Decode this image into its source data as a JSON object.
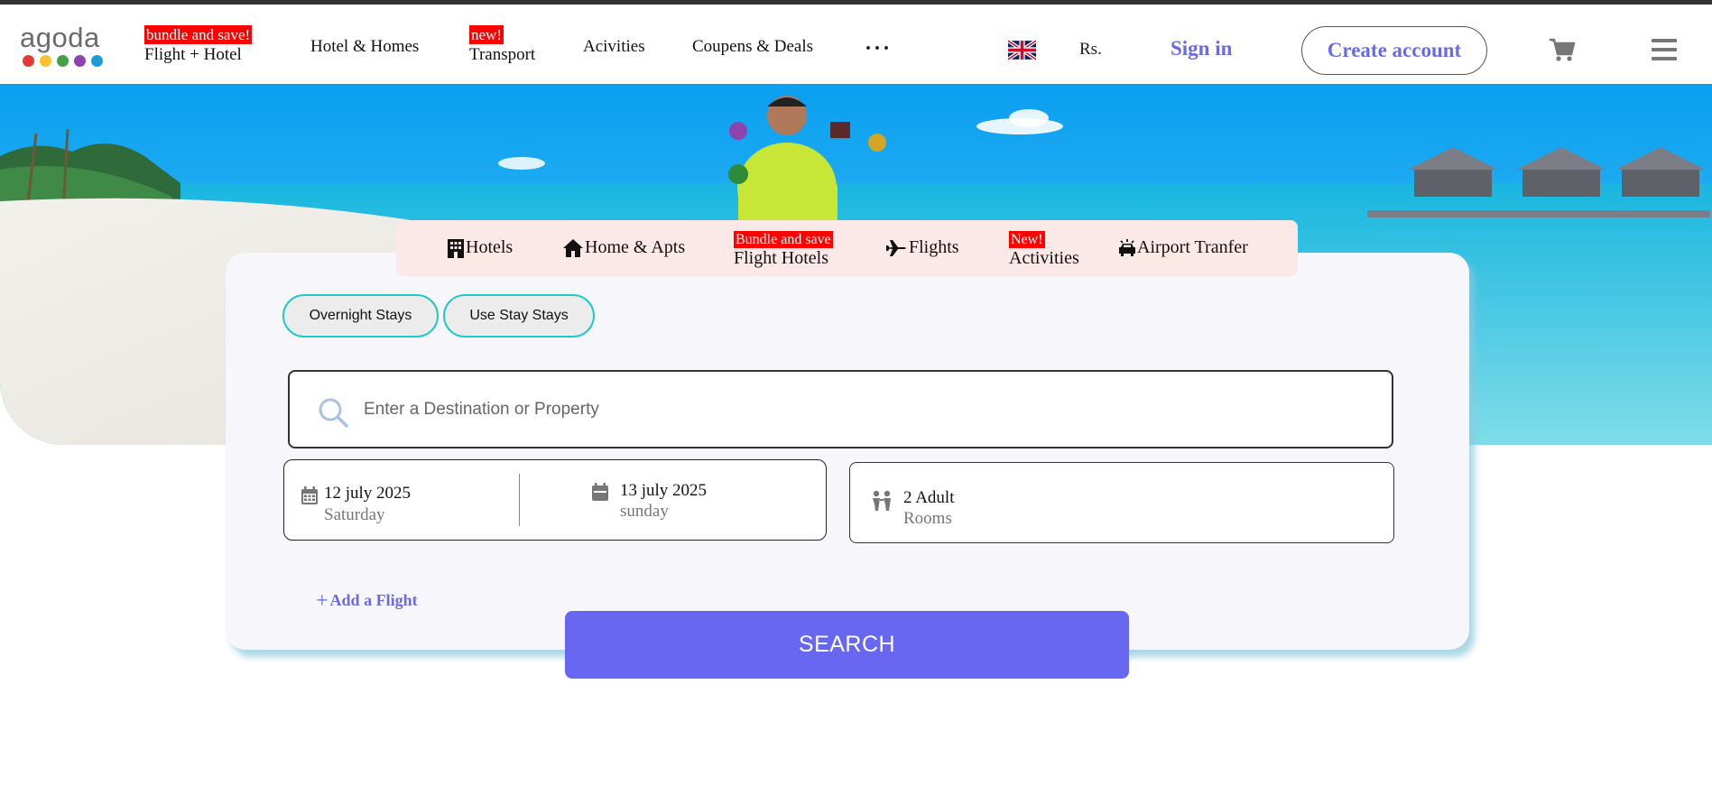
{
  "brand": {
    "logo_text": "agoda",
    "logo_dot_colors": [
      "#e53935",
      "#fbc02d",
      "#43a047",
      "#8e44ad",
      "#1e9bd7"
    ]
  },
  "header": {
    "nav": [
      {
        "badge": "bundle and save!",
        "label": "Flight + Hotel"
      },
      {
        "label": "Hotel & Homes"
      },
      {
        "badge": "new!",
        "label": "Transport"
      },
      {
        "label": "Acivities"
      },
      {
        "label": "Coupens & Deals"
      }
    ],
    "more_icon": "ellipsis-icon",
    "flag_icon": "uk-flag-icon",
    "currency": "Rs.",
    "sign_in": "Sign in",
    "create_account": "Create account",
    "cart_icon": "cart-icon",
    "menu_icon": "hamburger-menu-icon"
  },
  "tabs": [
    {
      "icon": "building-icon",
      "label": "Hotels"
    },
    {
      "icon": "house-icon",
      "label": "Home & Apts"
    },
    {
      "badge": "Bundle and save",
      "label": "Flight Hotels"
    },
    {
      "icon": "airplane-icon",
      "label": "Flights"
    },
    {
      "badge": "New!",
      "label": "Activities"
    },
    {
      "icon": "taxi-icon",
      "label": "Airport Tranfer"
    }
  ],
  "stay_types": [
    "Overnight Stays",
    "Use Stay Stays"
  ],
  "search": {
    "placeholder": "Enter a Destination or Property",
    "value": ""
  },
  "dates": {
    "check_in": {
      "date": "12 july 2025",
      "day": "Saturday"
    },
    "check_out": {
      "date": "13 july 2025",
      "day": "sunday"
    }
  },
  "guests": {
    "main": "2 Adult",
    "sub": "Rooms"
  },
  "add_flight": "Add a Flight",
  "search_button": "SEARCH",
  "colors": {
    "accent": "#6767f2",
    "link": "#6a6ae3",
    "badge": "#ff0000",
    "pill_border": "#1fc9c9",
    "tabs_bg": "#fbe9e7"
  }
}
